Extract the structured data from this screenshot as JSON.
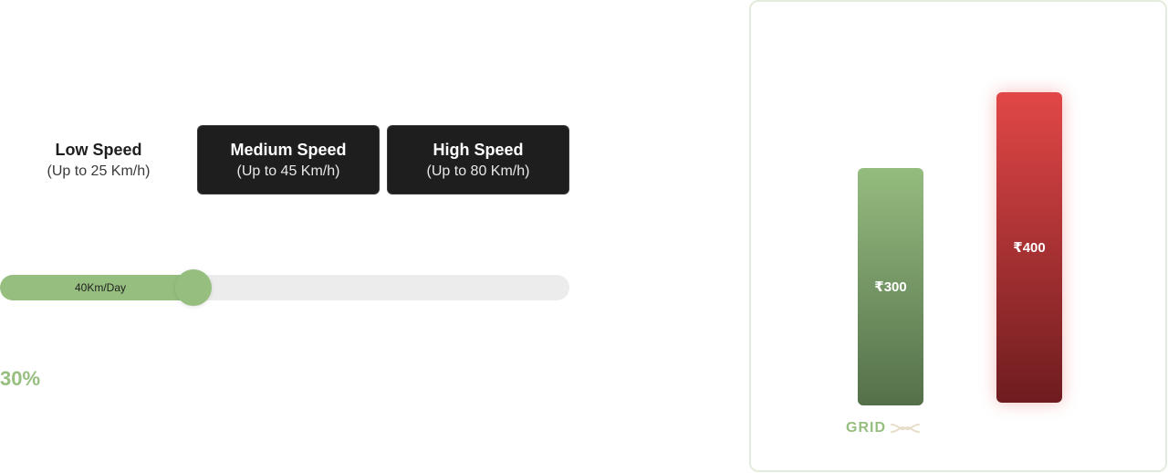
{
  "speed_options": [
    {
      "title": "Low Speed",
      "subtitle": "(Up to 25 Km/h)",
      "selected": true
    },
    {
      "title": "Medium Speed",
      "subtitle": "(Up to 45 Km/h)",
      "selected": false
    },
    {
      "title": "High Speed",
      "subtitle": "(Up to 80 Km/h)",
      "selected": false
    }
  ],
  "slider": {
    "label": "40Km/Day",
    "value_fraction": 0.34
  },
  "percent": "30%",
  "chart": {
    "bars": [
      {
        "label": "₹300",
        "value": 300,
        "color_start": "#95bc7f",
        "color_end": "#54704a"
      },
      {
        "label": "₹400",
        "value": 400,
        "color_start": "#e24747",
        "color_end": "#6e1c1f"
      }
    ],
    "brand": "GRID",
    "brand_icon": "infinity-icon"
  },
  "colors": {
    "accent": "#96bf7f",
    "dark": "#1e1e1e",
    "danger": "#e24747"
  }
}
